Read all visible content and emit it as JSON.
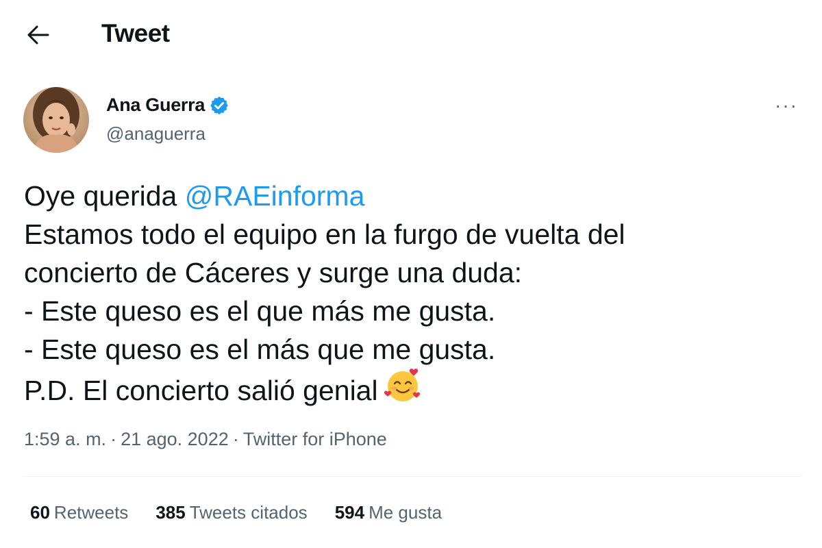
{
  "header": {
    "title": "Tweet",
    "back_icon": "arrow-left-icon"
  },
  "author": {
    "name": "Ana Guerra",
    "handle": "@anaguerra",
    "verified_icon": "verified-badge-icon",
    "verified_color": "#1d9bf0"
  },
  "more_icon": "ellipsis-icon",
  "more_label": "···",
  "tweet": {
    "line1_prefix": "Oye querida ",
    "mention": "@RAEinforma",
    "line2": "Estamos todo el equipo en la furgo de vuelta del",
    "line3": "concierto de Cáceres y surge una duda:",
    "line4": "- Este queso es el que más me gusta.",
    "line5": "- Este queso es el más que me gusta.",
    "line6": "P.D. El concierto salió genial",
    "emoji_icon": "smiling-face-with-hearts-icon"
  },
  "meta": {
    "time": "1:59 a. m.",
    "separator": "·",
    "date": "21 ago. 2022",
    "source": "Twitter for iPhone"
  },
  "stats": {
    "retweets_count": "60",
    "retweets_label": "Retweets",
    "quotes_count": "385",
    "quotes_label": "Tweets citados",
    "likes_count": "594",
    "likes_label": "Me gusta"
  },
  "colors": {
    "text": "#0f1419",
    "secondary": "#536471",
    "accent": "#1d9bf0",
    "divider": "#eff3f4"
  }
}
